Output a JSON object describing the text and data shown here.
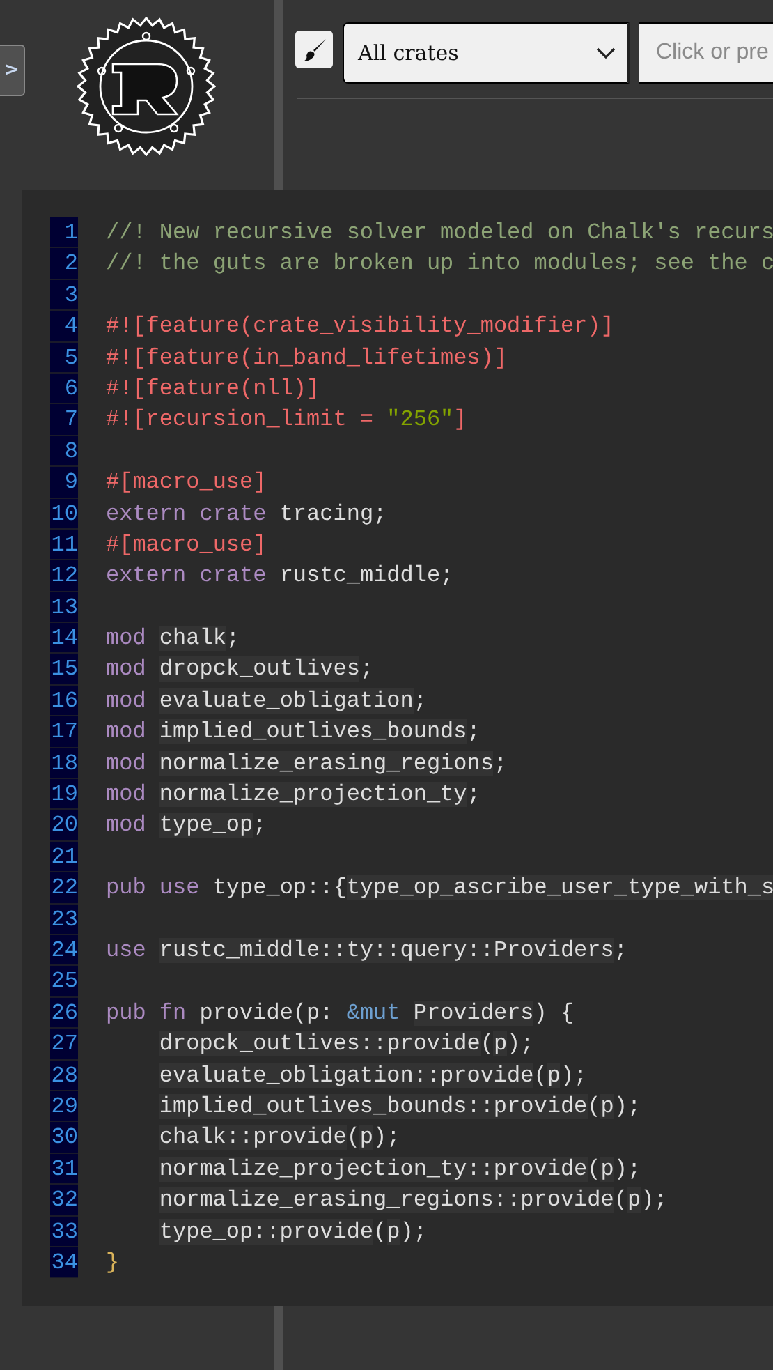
{
  "sidebar": {
    "toggle_label": ">"
  },
  "search_bar": {
    "crate_select": "All crates",
    "placeholder": "Click or pre"
  },
  "source": {
    "lines": [
      {
        "number": "1",
        "tokens": [
          {
            "kind": "comment",
            "text": "//! New recursive solver modeled on Chalk's recurs"
          }
        ]
      },
      {
        "number": "2",
        "tokens": [
          {
            "kind": "comment",
            "text": "//! the guts are broken up into modules; see the c"
          }
        ]
      },
      {
        "number": "3"
      },
      {
        "number": "4",
        "tokens": [
          {
            "kind": "attr",
            "text": "#![feature(crate_visibility_modifier)]"
          }
        ]
      },
      {
        "number": "5",
        "tokens": [
          {
            "kind": "attr",
            "text": "#![feature(in_band_lifetimes)]"
          }
        ]
      },
      {
        "number": "6",
        "tokens": [
          {
            "kind": "attr",
            "text": "#![feature(nll)]"
          }
        ]
      },
      {
        "number": "7",
        "tokens": [
          {
            "kind": "attr",
            "text": "#![recursion_limit = "
          },
          {
            "kind": "string",
            "text": "\"256\""
          },
          {
            "kind": "attr",
            "text": "]"
          }
        ]
      },
      {
        "number": "8"
      },
      {
        "number": "9",
        "tokens": [
          {
            "kind": "attr",
            "text": "#[macro_use]"
          }
        ]
      },
      {
        "number": "10",
        "tokens": [
          {
            "kind": "keyword",
            "text": "extern crate "
          },
          {
            "kind": "plain",
            "text": "tracing;"
          }
        ]
      },
      {
        "number": "11",
        "tokens": [
          {
            "kind": "attr",
            "text": "#[macro_use]"
          }
        ]
      },
      {
        "number": "12",
        "tokens": [
          {
            "kind": "keyword",
            "text": "extern crate "
          },
          {
            "kind": "plain",
            "text": "rustc_middle;"
          }
        ]
      },
      {
        "number": "13"
      },
      {
        "number": "14",
        "tokens": [
          {
            "kind": "keyword",
            "text": "mod "
          },
          {
            "kind": "link",
            "text": "chalk"
          },
          {
            "kind": "plain",
            "text": ";"
          }
        ]
      },
      {
        "number": "15",
        "tokens": [
          {
            "kind": "keyword",
            "text": "mod "
          },
          {
            "kind": "link",
            "text": "dropck_outlives"
          },
          {
            "kind": "plain",
            "text": ";"
          }
        ]
      },
      {
        "number": "16",
        "tokens": [
          {
            "kind": "keyword",
            "text": "mod "
          },
          {
            "kind": "link",
            "text": "evaluate_obligation"
          },
          {
            "kind": "plain",
            "text": ";"
          }
        ]
      },
      {
        "number": "17",
        "tokens": [
          {
            "kind": "keyword",
            "text": "mod "
          },
          {
            "kind": "link",
            "text": "implied_outlives_bounds"
          },
          {
            "kind": "plain",
            "text": ";"
          }
        ]
      },
      {
        "number": "18",
        "tokens": [
          {
            "kind": "keyword",
            "text": "mod "
          },
          {
            "kind": "link",
            "text": "normalize_erasing_regions"
          },
          {
            "kind": "plain",
            "text": ";"
          }
        ]
      },
      {
        "number": "19",
        "tokens": [
          {
            "kind": "keyword",
            "text": "mod "
          },
          {
            "kind": "link",
            "text": "normalize_projection_ty"
          },
          {
            "kind": "plain",
            "text": ";"
          }
        ]
      },
      {
        "number": "20",
        "tokens": [
          {
            "kind": "keyword",
            "text": "mod "
          },
          {
            "kind": "link",
            "text": "type_op"
          },
          {
            "kind": "plain",
            "text": ";"
          }
        ]
      },
      {
        "number": "21"
      },
      {
        "number": "22",
        "tokens": [
          {
            "kind": "keyword",
            "text": "pub use "
          },
          {
            "kind": "plain",
            "text": "type_op::{"
          },
          {
            "kind": "link",
            "text": "type_op_ascribe_user_type_with_s"
          }
        ]
      },
      {
        "number": "23"
      },
      {
        "number": "24",
        "tokens": [
          {
            "kind": "keyword",
            "text": "use "
          },
          {
            "kind": "link",
            "text": "rustc_middle::ty::query::Providers"
          },
          {
            "kind": "plain",
            "text": ";"
          }
        ]
      },
      {
        "number": "25"
      },
      {
        "number": "26",
        "tokens": [
          {
            "kind": "keyword",
            "text": "pub fn "
          },
          {
            "kind": "plain",
            "text": "provide(p: "
          },
          {
            "kind": "ref",
            "text": "&mut "
          },
          {
            "kind": "link",
            "text": "Providers"
          },
          {
            "kind": "plain",
            "text": ") {"
          }
        ]
      },
      {
        "number": "27",
        "indented": true,
        "tokens": [
          {
            "kind": "link",
            "text": "dropck_outlives::provide"
          },
          {
            "kind": "plain",
            "text": "("
          },
          {
            "kind": "link",
            "text": "p"
          },
          {
            "kind": "plain",
            "text": ");"
          }
        ]
      },
      {
        "number": "28",
        "indented": true,
        "tokens": [
          {
            "kind": "link",
            "text": "evaluate_obligation::provide"
          },
          {
            "kind": "plain",
            "text": "("
          },
          {
            "kind": "link",
            "text": "p"
          },
          {
            "kind": "plain",
            "text": ");"
          }
        ]
      },
      {
        "number": "29",
        "indented": true,
        "tokens": [
          {
            "kind": "link",
            "text": "implied_outlives_bounds::provide"
          },
          {
            "kind": "plain",
            "text": "("
          },
          {
            "kind": "link",
            "text": "p"
          },
          {
            "kind": "plain",
            "text": ");"
          }
        ]
      },
      {
        "number": "30",
        "indented": true,
        "tokens": [
          {
            "kind": "link",
            "text": "chalk::provide"
          },
          {
            "kind": "plain",
            "text": "("
          },
          {
            "kind": "link",
            "text": "p"
          },
          {
            "kind": "plain",
            "text": ");"
          }
        ]
      },
      {
        "number": "31",
        "indented": true,
        "tokens": [
          {
            "kind": "link",
            "text": "normalize_projection_ty::provide"
          },
          {
            "kind": "plain",
            "text": "("
          },
          {
            "kind": "link",
            "text": "p"
          },
          {
            "kind": "plain",
            "text": ");"
          }
        ]
      },
      {
        "number": "32",
        "indented": true,
        "tokens": [
          {
            "kind": "link",
            "text": "normalize_erasing_regions::provide"
          },
          {
            "kind": "plain",
            "text": "("
          },
          {
            "kind": "link",
            "text": "p"
          },
          {
            "kind": "plain",
            "text": ");"
          }
        ]
      },
      {
        "number": "33",
        "indented": true,
        "tokens": [
          {
            "kind": "link",
            "text": "type_op::provide"
          },
          {
            "kind": "plain",
            "text": "("
          },
          {
            "kind": "link",
            "text": "p"
          },
          {
            "kind": "plain",
            "text": ");"
          }
        ]
      },
      {
        "number": "34",
        "tokens": [
          {
            "kind": "brace",
            "text": "}"
          }
        ]
      }
    ]
  }
}
